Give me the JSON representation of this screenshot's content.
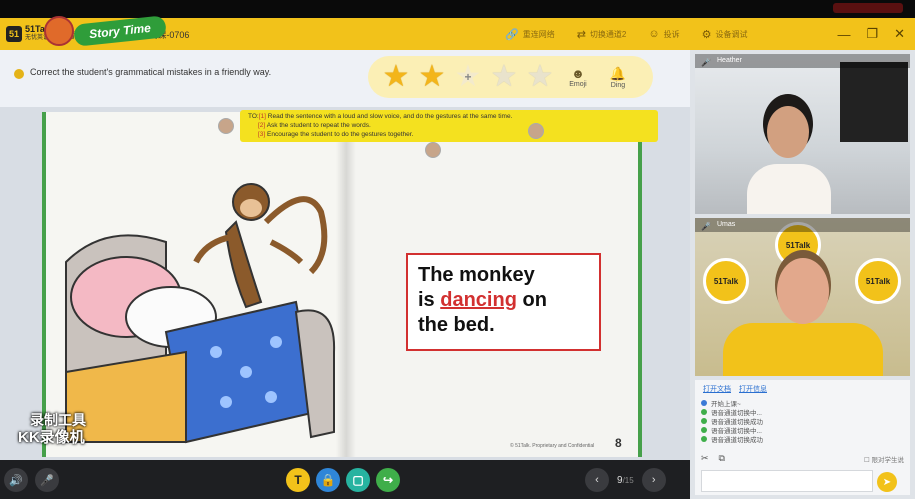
{
  "app": {
    "logo_mark": "51",
    "logo_name": "51Talk",
    "logo_sub": "无忧英语",
    "breadcrumb": "青少试课>美小 >G2-试课-0706"
  },
  "title_actions": [
    {
      "icon": "link-icon",
      "glyph": "🔗",
      "label": "重连网络"
    },
    {
      "icon": "shuffle-icon",
      "glyph": "⇄",
      "label": "切换通道2"
    },
    {
      "icon": "feedback-icon",
      "glyph": "☺",
      "label": "投诉"
    },
    {
      "icon": "settings-icon",
      "glyph": "⚙",
      "label": "设备调试"
    }
  ],
  "window_controls": {
    "minimize": "—",
    "restore": "❐",
    "close": "✕"
  },
  "instruction": "Correct the student's grammatical mistakes in a friendly way.",
  "rating": {
    "stars_filled": 2,
    "stars_total": 5,
    "emoji_label": "Emoji",
    "ding_label": "Ding",
    "emoji_glyph": "☻",
    "ding_glyph": "🔔"
  },
  "lesson": {
    "badge": "Story Time",
    "teacher_note": {
      "prefix": "TO:",
      "items": [
        {
          "num": "[1]",
          "text": "Read the sentence with a loud and slow voice, and do the gestures at the same time."
        },
        {
          "num": "[2]",
          "text": "Ask the student to repeat the words."
        },
        {
          "num": "[3]",
          "text": "Encourage the student to do the gestures together."
        }
      ]
    },
    "sentence": {
      "line1": "The monkey",
      "line2_pre": "is ",
      "line2_highlight": "dancing",
      "line2_post": " on",
      "line3": "the bed."
    },
    "copyright": "© 51Talk. Proprietary and Confidential",
    "page_number": "8",
    "watermark_line1": "录制工具",
    "watermark_line2": "KK录像机"
  },
  "bottom_bar": {
    "speaker_glyph": "🔊",
    "mic_glyph": "🎤",
    "tools": [
      {
        "name": "text-tool-button",
        "glyph": "T",
        "color": "#f2c21a"
      },
      {
        "name": "lock-tool-button",
        "glyph": "🔒",
        "color": "#2f86d8"
      },
      {
        "name": "select-tool-button",
        "glyph": "▢",
        "color": "#27b3a0"
      },
      {
        "name": "share-tool-button",
        "glyph": "↪",
        "color": "#3fae4a"
      }
    ],
    "prev_glyph": "‹",
    "next_glyph": "›",
    "page_current": "9",
    "page_total": "/15"
  },
  "videos": {
    "student_name": "Heather",
    "teacher_name": "Umas",
    "logo_text": "51Talk"
  },
  "chat": {
    "tab_open_doc": "打开文档",
    "tab_open_info": "打开信息",
    "messages": [
      {
        "text": "开始上课~",
        "color": "#3b7ad6"
      },
      {
        "text": "语音通道切换中...",
        "color": "#3fae4a"
      },
      {
        "text": "语音通道切换成功",
        "color": "#3fae4a"
      },
      {
        "text": "语音通道切换中...",
        "color": "#3fae4a"
      },
      {
        "text": "语音通道切换成功",
        "color": "#3fae4a"
      }
    ],
    "scissor_glyph": "✂",
    "screenshot_glyph": "⧉",
    "tip": "☐ 限对学生说",
    "send_glyph": "➤"
  }
}
